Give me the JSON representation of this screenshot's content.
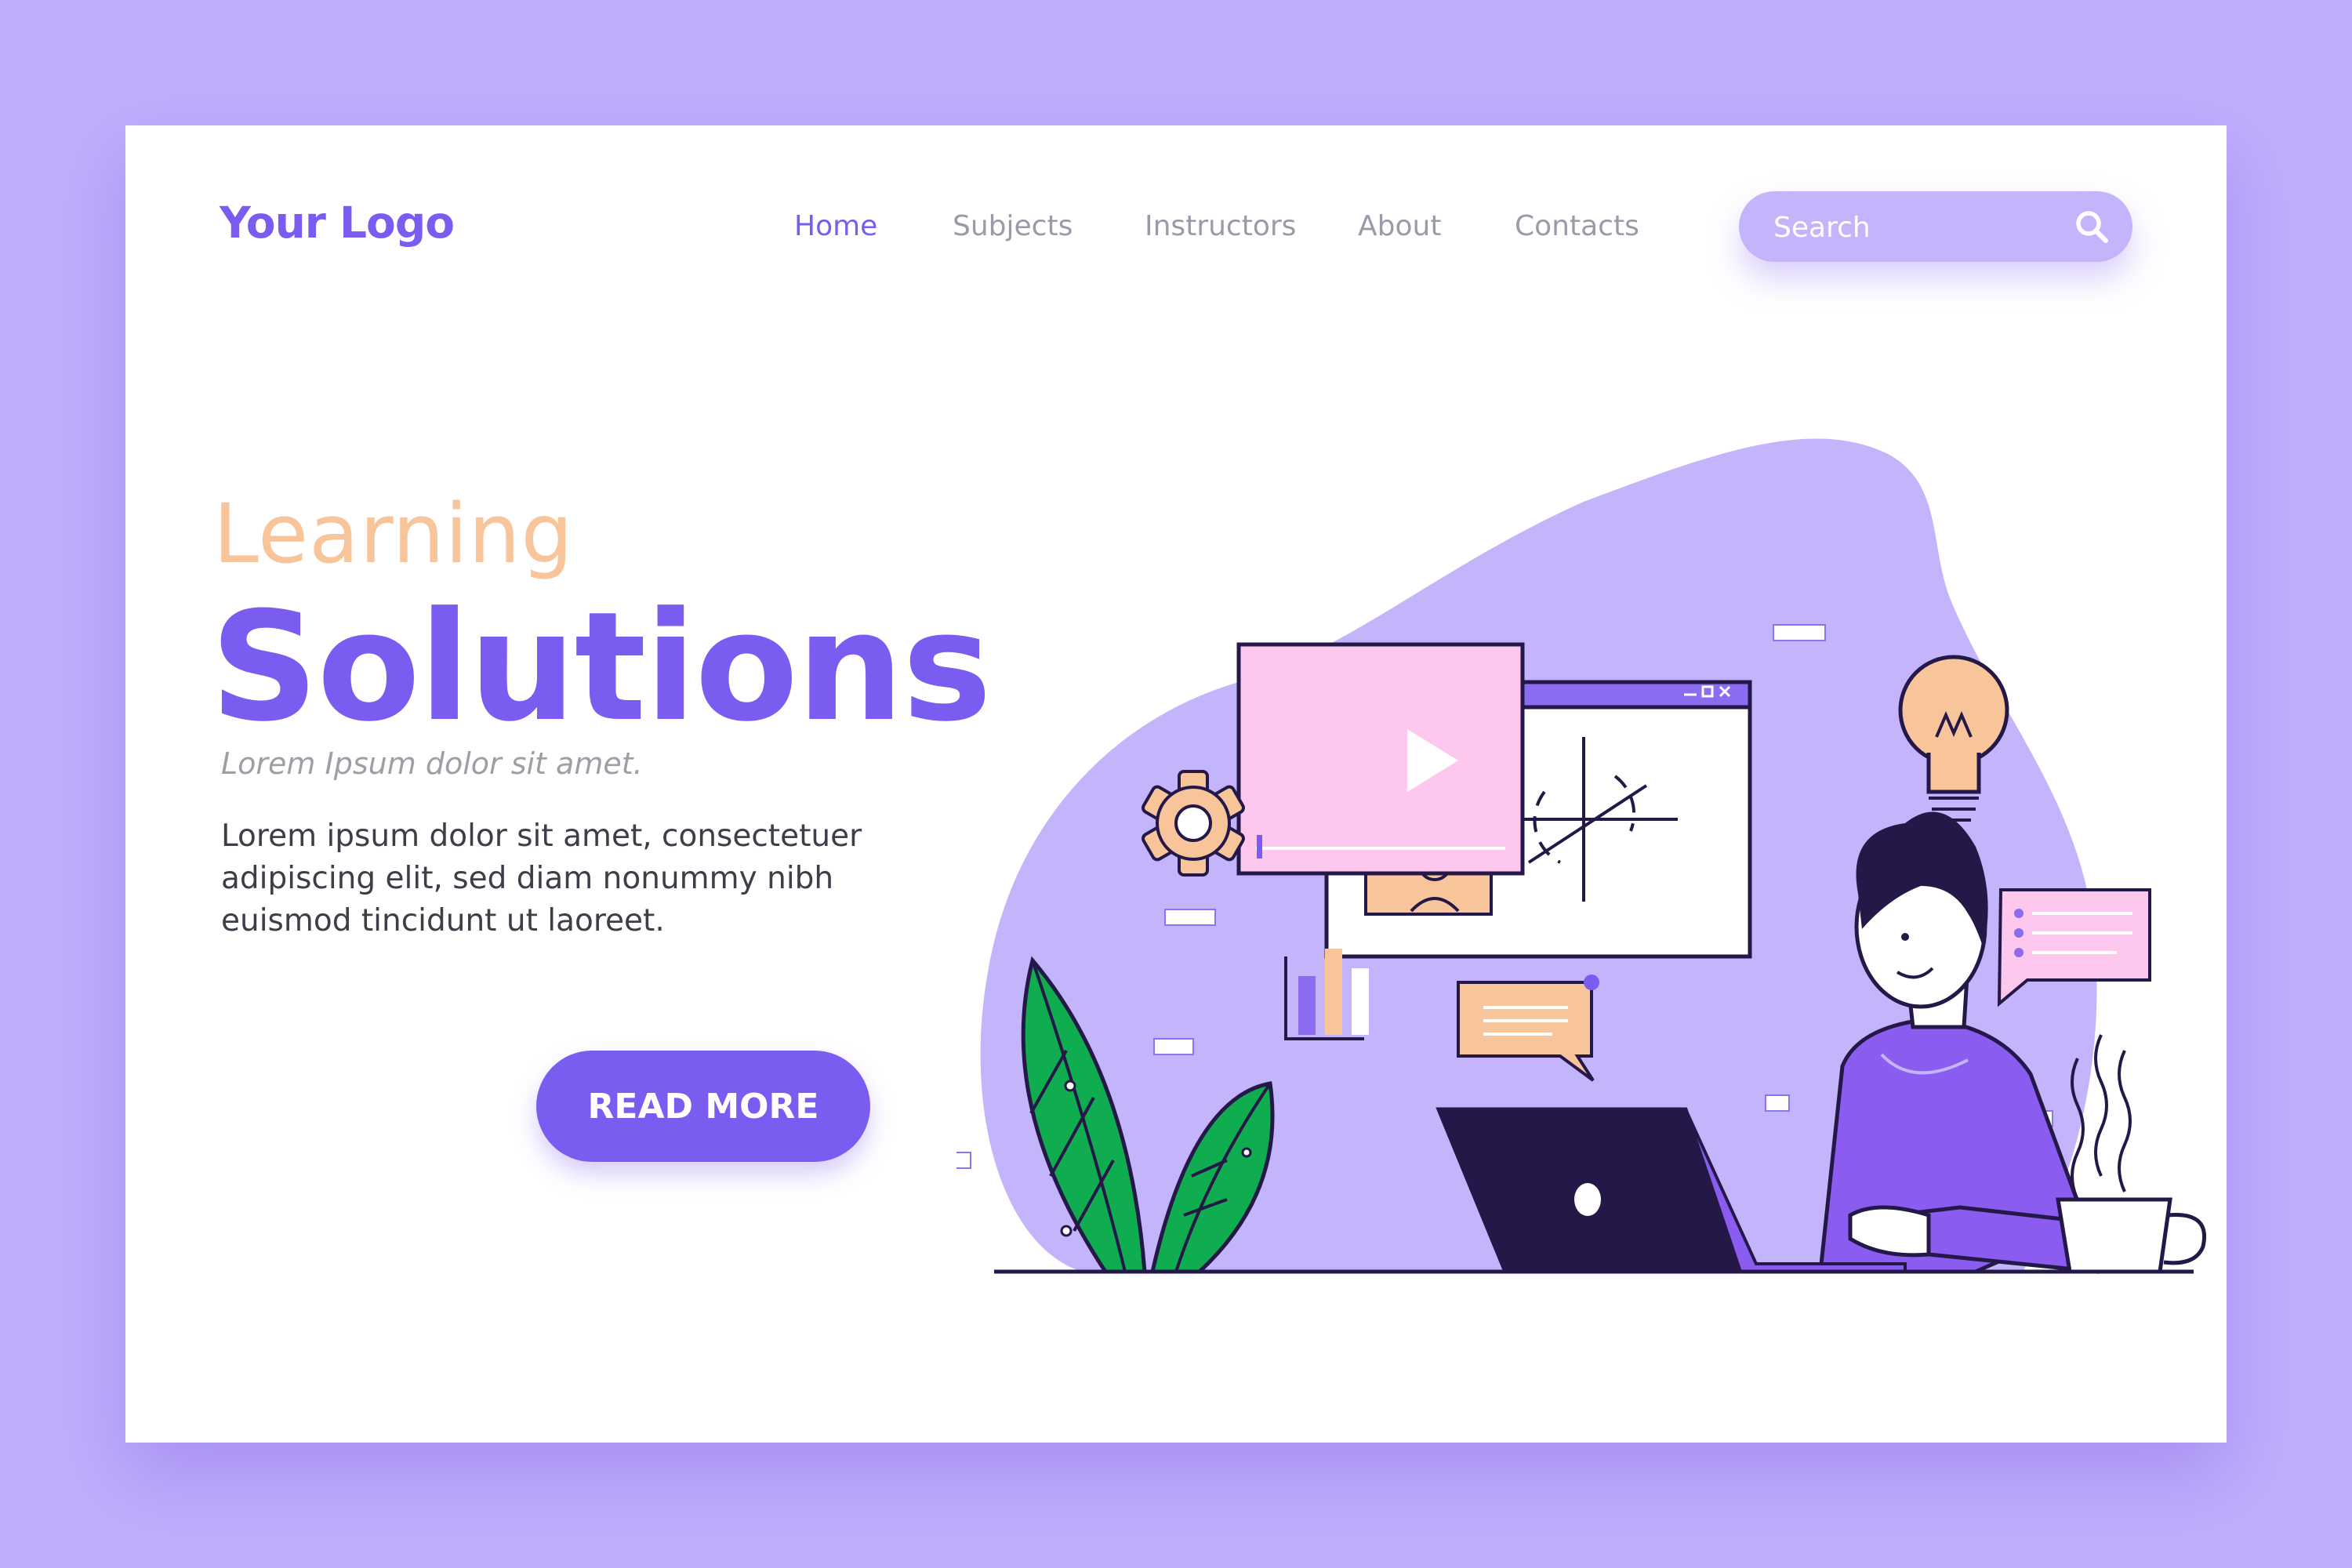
{
  "header": {
    "logo": "Your Logo",
    "nav": [
      "Home",
      "Subjects",
      "Instructors",
      "About",
      "Contacts"
    ],
    "active_nav": "Home",
    "search_placeholder": "Search"
  },
  "hero": {
    "title_small": "Learning",
    "title_big": "Solutions",
    "subtitle": "Lorem Ipsum dolor sit amet.",
    "body": "Lorem ipsum dolor sit amet, consectetuer adipiscing elit, sed diam nonummy nibh euismod tincidunt ut laoreet.",
    "cta_label": "READ MORE"
  },
  "colors": {
    "background": "#c0aefd",
    "accent": "#7b5cf0",
    "peach": "#f8c49a",
    "blob": "#c4b4fb",
    "leaf": "#0fad4f",
    "pink": "#fdc7ee",
    "dark": "#241848"
  },
  "icons": [
    "search-icon",
    "gear-icon",
    "lightbulb-icon",
    "play-icon",
    "chat-bubble-icon",
    "bar-chart-icon",
    "coffee-cup-icon",
    "laptop-icon",
    "plant-icon"
  ]
}
